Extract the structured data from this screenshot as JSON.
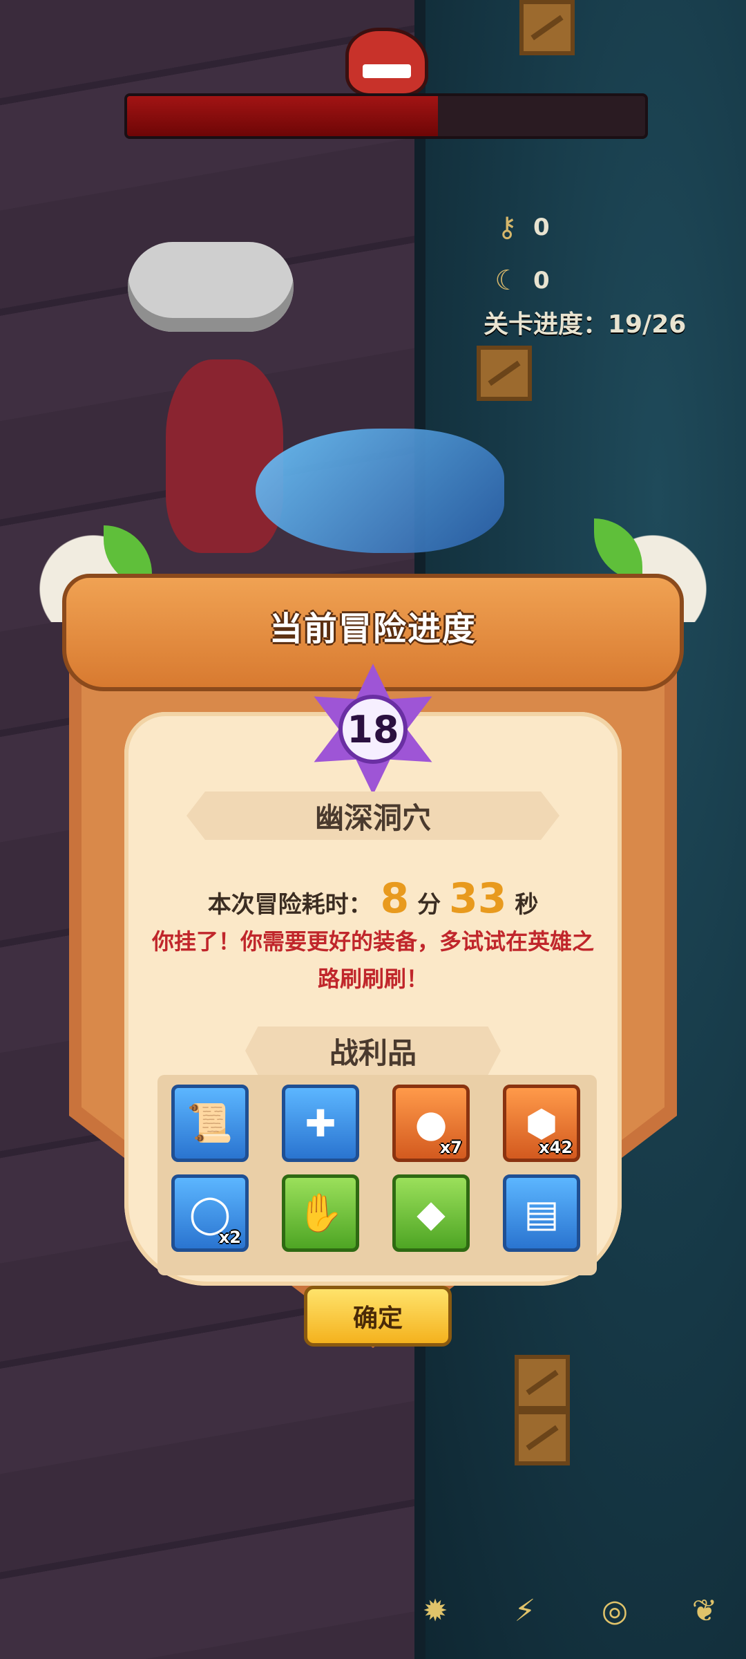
{
  "boss_health_fraction": 0.6,
  "resources": [
    {
      "icon": "key-icon",
      "value": "0"
    },
    {
      "icon": "claw-icon",
      "value": "0"
    }
  ],
  "stage_progress": "关卡进度：19/26",
  "panel": {
    "title": "当前冒险进度",
    "level": "18",
    "location": "幽深洞穴",
    "time_label": "本次冒险耗时：",
    "minutes": "8",
    "min_unit": "分",
    "seconds": "33",
    "sec_unit": "秒",
    "fail_line1": "你挂了！你需要更好的装备，多试试在英雄之",
    "fail_line2": "路刷刷刷！",
    "loot_title": "战利品",
    "confirm": "确定"
  },
  "loot": [
    {
      "icon": "scroll-icon",
      "rarity": "blue",
      "count": ""
    },
    {
      "icon": "amulet-icon",
      "rarity": "blue",
      "count": ""
    },
    {
      "icon": "orb-icon",
      "rarity": "orange",
      "count": "x7"
    },
    {
      "icon": "hex-nut-icon",
      "rarity": "orange",
      "count": "x42"
    },
    {
      "icon": "ring-icon",
      "rarity": "blue",
      "count": "x2"
    },
    {
      "icon": "gauntlet-icon",
      "rarity": "green",
      "count": ""
    },
    {
      "icon": "crystal-icon",
      "rarity": "green",
      "count": ""
    },
    {
      "icon": "map-scroll-icon",
      "rarity": "blue",
      "count": ""
    }
  ]
}
